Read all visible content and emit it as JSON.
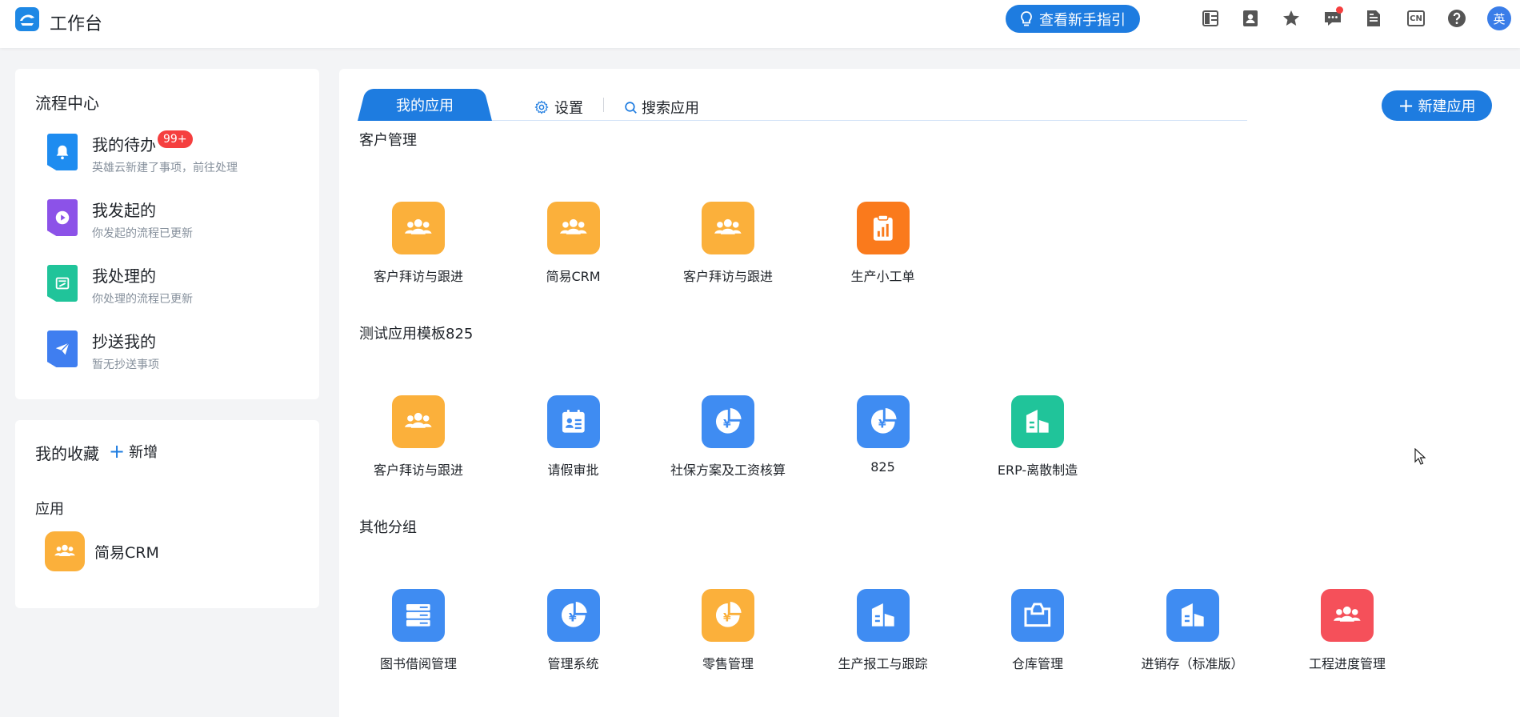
{
  "header": {
    "title": "工作台",
    "guide_label": "查看新手指引",
    "lang_code": "CN",
    "user_avatar": "英",
    "icons": [
      "layout-icon",
      "contacts-icon",
      "star-icon",
      "message-icon",
      "document-icon",
      "language-icon",
      "help-icon"
    ]
  },
  "flow_center": {
    "title": "流程中心",
    "items": [
      {
        "name": "我的待办",
        "badge": "99+",
        "desc": "英雄云新建了事项，前往处理",
        "icon": "bell-icon",
        "color": "#1e8cf0"
      },
      {
        "name": "我发起的",
        "desc": "你发起的流程已更新",
        "icon": "play-icon",
        "color": "#8c52e8"
      },
      {
        "name": "我处理的",
        "desc": "你处理的流程已更新",
        "icon": "inbox-icon",
        "color": "#20c49a"
      },
      {
        "name": "抄送我的",
        "desc": "暂无抄送事项",
        "icon": "send-icon",
        "color": "#3f7ef0"
      }
    ]
  },
  "favorites": {
    "title": "我的收藏",
    "add_label": "新增",
    "section_label": "应用",
    "apps": [
      {
        "name": "简易CRM",
        "icon": "people-icon",
        "color": "#fbb03b"
      }
    ]
  },
  "main": {
    "tabs": {
      "active": "我的应用",
      "settings": "设置",
      "search": "搜索应用"
    },
    "new_app_label": "新建应用",
    "groups": [
      {
        "title": "客户管理",
        "apps": [
          {
            "name": "客户拜访与跟进",
            "icon": "people-icon",
            "color": "#fbb03b"
          },
          {
            "name": "简易CRM",
            "icon": "people-icon",
            "color": "#fbb03b"
          },
          {
            "name": "客户拜访与跟进",
            "icon": "people-icon",
            "color": "#fbb03b"
          },
          {
            "name": "生产小工单",
            "icon": "clipboard-chart-icon",
            "color": "#fa7a1c"
          }
        ]
      },
      {
        "title": "测试应用模板825",
        "apps": [
          {
            "name": "客户拜访与跟进",
            "icon": "people-icon",
            "color": "#fbb03b"
          },
          {
            "name": "请假审批",
            "icon": "id-card-icon",
            "color": "#3f8cf2"
          },
          {
            "name": "社保方案及工资核算",
            "icon": "yuan-pie-icon",
            "color": "#3f8cf2"
          },
          {
            "name": "825",
            "icon": "yuan-pie-icon",
            "color": "#3f8cf2"
          },
          {
            "name": "ERP-离散制造",
            "icon": "building-icon",
            "color": "#20c49a"
          }
        ]
      },
      {
        "title": "其他分组",
        "apps": [
          {
            "name": "图书借阅管理",
            "icon": "server-icon",
            "color": "#3f8cf2"
          },
          {
            "name": "管理系统",
            "icon": "yuan-pie-icon",
            "color": "#3f8cf2"
          },
          {
            "name": "零售管理",
            "icon": "yuan-pie-icon",
            "color": "#fbb03b"
          },
          {
            "name": "生产报工与跟踪",
            "icon": "building-icon",
            "color": "#3f8cf2"
          },
          {
            "name": "仓库管理",
            "icon": "box-icon",
            "color": "#3f8cf2"
          },
          {
            "name": "进销存（标准版）",
            "icon": "building-icon",
            "color": "#3f8cf2"
          },
          {
            "name": "工程进度管理",
            "icon": "people-icon",
            "color": "#f5505a"
          }
        ]
      }
    ]
  }
}
